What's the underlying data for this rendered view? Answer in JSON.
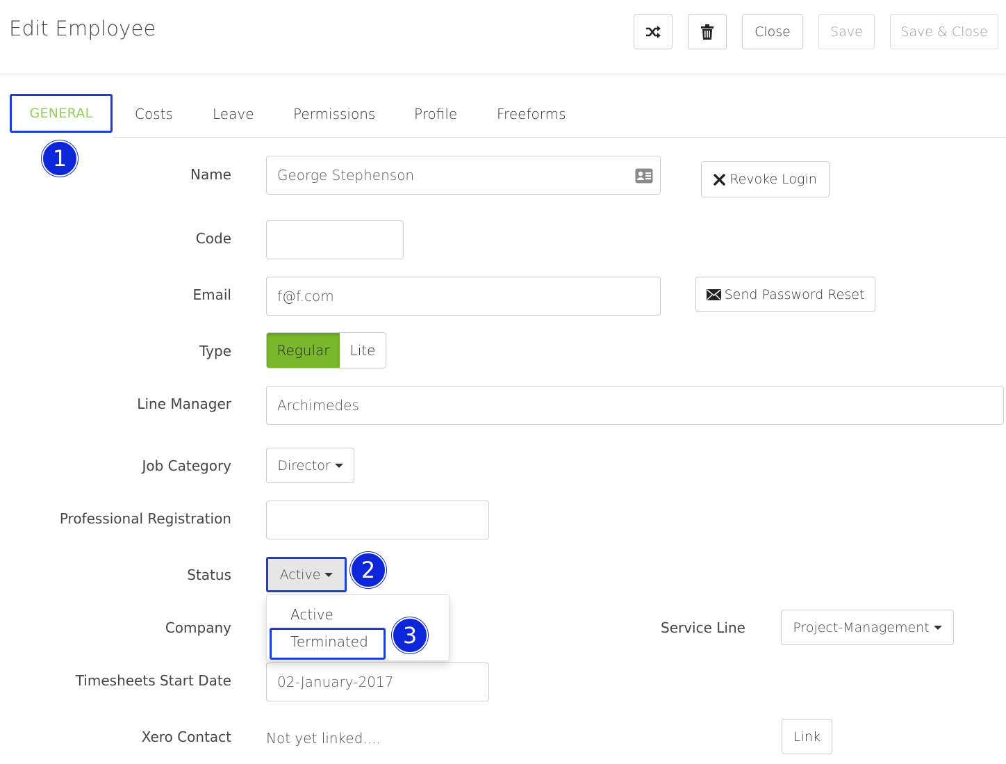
{
  "header": {
    "title": "Edit Employee",
    "close_label": "Close",
    "save_label": "Save",
    "save_close_label": "Save & Close"
  },
  "tabs": [
    {
      "label": "GENERAL"
    },
    {
      "label": "Costs"
    },
    {
      "label": "Leave"
    },
    {
      "label": "Permissions"
    },
    {
      "label": "Profile"
    },
    {
      "label": "Freeforms"
    }
  ],
  "markers": [
    "1",
    "2",
    "3"
  ],
  "form": {
    "name": {
      "label": "Name",
      "value": "George Stephenson"
    },
    "code": {
      "label": "Code",
      "value": ""
    },
    "email": {
      "label": "Email",
      "value": "f@f.com"
    },
    "type": {
      "label": "Type",
      "options": [
        "Regular",
        "Lite"
      ],
      "selected": "Regular"
    },
    "line_manager": {
      "label": "Line Manager",
      "value": "Archimedes"
    },
    "job_category": {
      "label": "Job Category",
      "value": "Director"
    },
    "professional_registration": {
      "label": "Professional Registration",
      "value": ""
    },
    "status": {
      "label": "Status",
      "value": "Active",
      "options": [
        "Active",
        "Terminated"
      ]
    },
    "company": {
      "label": "Company"
    },
    "service_line": {
      "label": "Service Line",
      "value": "Project-Management"
    },
    "timesheets_start_date": {
      "label": "Timesheets Start Date",
      "value": "02-January-2017"
    },
    "xero_contact": {
      "label": "Xero Contact",
      "value": "Not yet linked....",
      "link_label": "Link"
    }
  },
  "actions": {
    "revoke_login": "Revoke Login",
    "send_password_reset": "Send Password Reset"
  },
  "colors": {
    "accent_green": "#78b82a",
    "tab_active_text": "#92cf5c",
    "annotation_blue": "#0d26d9"
  }
}
